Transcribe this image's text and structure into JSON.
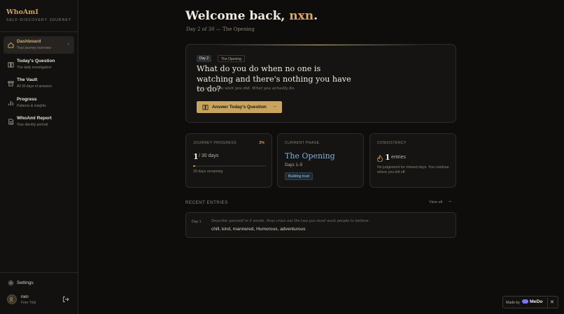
{
  "brand": {
    "title": "WhoAmI",
    "subtitle": "SELF-DISCOVERY JOURNEY",
    "accent": "#c9a45c"
  },
  "sidebar": {
    "items": [
      {
        "label": "Dashboard",
        "sub": "Your journey overview",
        "icon": "home-icon",
        "active": true
      },
      {
        "label": "Today's Question",
        "sub": "The daily investigation",
        "icon": "book-icon",
        "active": false
      },
      {
        "label": "The Vault",
        "sub": "All 30 days of answers",
        "icon": "archive-icon",
        "active": false
      },
      {
        "label": "Progress",
        "sub": "Patterns & insights",
        "icon": "bar-chart-icon",
        "active": false
      },
      {
        "label": "WhoAmI Report",
        "sub": "Your identity portrait",
        "icon": "document-icon",
        "active": false
      }
    ],
    "settings_label": "Settings",
    "user": {
      "name": "nxn",
      "plan": "Free Trial"
    }
  },
  "header": {
    "welcome_prefix": "Welcome back,",
    "user_name": "nxn",
    "welcome_suffix": ".",
    "subtitle": "Day 2 of 30 — The Opening"
  },
  "question_card": {
    "day_chip": "Day 2",
    "phase_chip": "The Opening",
    "question": "What do you do when no one is watching and there's nothing you have to do?",
    "hint": "Not what you wish you did. What you actually do.",
    "button_label": "Answer Today's Question"
  },
  "stats": {
    "progress": {
      "heading": "JOURNEY PROGRESS",
      "percent": "3%",
      "current": "1",
      "total": "/ 30 days",
      "fraction": 0.033,
      "remaining": "29 days remaining"
    },
    "phase": {
      "heading": "CURRENT PHASE",
      "name": "The Opening",
      "days": "Days 1–5",
      "badge": "Building trust",
      "color": "#7fb0d8"
    },
    "consistency": {
      "heading": "CONSISTENCY",
      "count": "1",
      "unit": "entries",
      "note": "No judgement for missed days. You continue where you left off."
    }
  },
  "recent": {
    "heading": "RECENT ENTRIES",
    "view_all": "View all",
    "entries": [
      {
        "day": "Day 1",
        "prompt": "Describe yourself in 5 words. Now cross out the two you most want people to believe.",
        "answer": "chill, kind, mannered, Humorous, adventurous"
      }
    ]
  },
  "badge": {
    "made_by": "Made by",
    "logo": "MeDo"
  }
}
